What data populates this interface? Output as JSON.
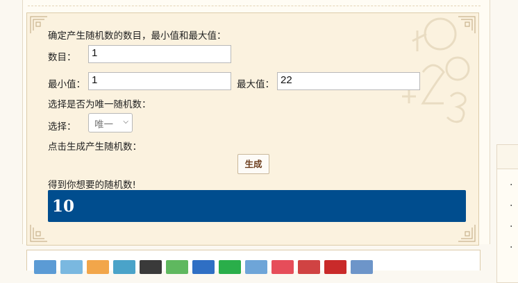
{
  "form": {
    "heading": "确定产生随机数的数目，最小值和最大值：",
    "count_label": "数目：",
    "count_value": "1",
    "min_label": "最小值：",
    "min_value": "1",
    "max_label": "最大值：",
    "max_value": "22",
    "unique_heading": "选择是否为唯一随机数：",
    "select_label": "选择：",
    "select_value": "唯一",
    "click_heading": "点击生成产生随机数：",
    "generate_label": "生成",
    "result_heading": "得到你想要的随机数!",
    "result_value": "10"
  },
  "colors": {
    "result_bar": "#004d8e",
    "panel_bg": "#fbf2df",
    "button_text": "#6b3c1c"
  },
  "icon_strip": [
    {
      "icon": "app-icon-blue",
      "color": "#5b9bd5"
    },
    {
      "icon": "app-icon-star",
      "color": "#7ab8e0"
    },
    {
      "icon": "app-icon-orange",
      "color": "#f2a64a"
    },
    {
      "icon": "app-icon-teal",
      "color": "#4aa3c9"
    },
    {
      "icon": "app-icon-avatar",
      "color": "#3a3a3a"
    },
    {
      "icon": "app-icon-paw",
      "color": "#5fb85f"
    },
    {
      "icon": "app-icon-baidu",
      "color": "#2f6fc4"
    },
    {
      "icon": "app-icon-chat",
      "color": "#2aae4a"
    },
    {
      "icon": "app-icon-blue2",
      "color": "#6ea5d8"
    },
    {
      "icon": "app-icon-red",
      "color": "#e64d5a"
    },
    {
      "icon": "app-icon-ribbon",
      "color": "#d04343"
    },
    {
      "icon": "app-icon-info",
      "color": "#c92a2a"
    },
    {
      "icon": "app-icon-window",
      "color": "#6d95c9"
    }
  ]
}
